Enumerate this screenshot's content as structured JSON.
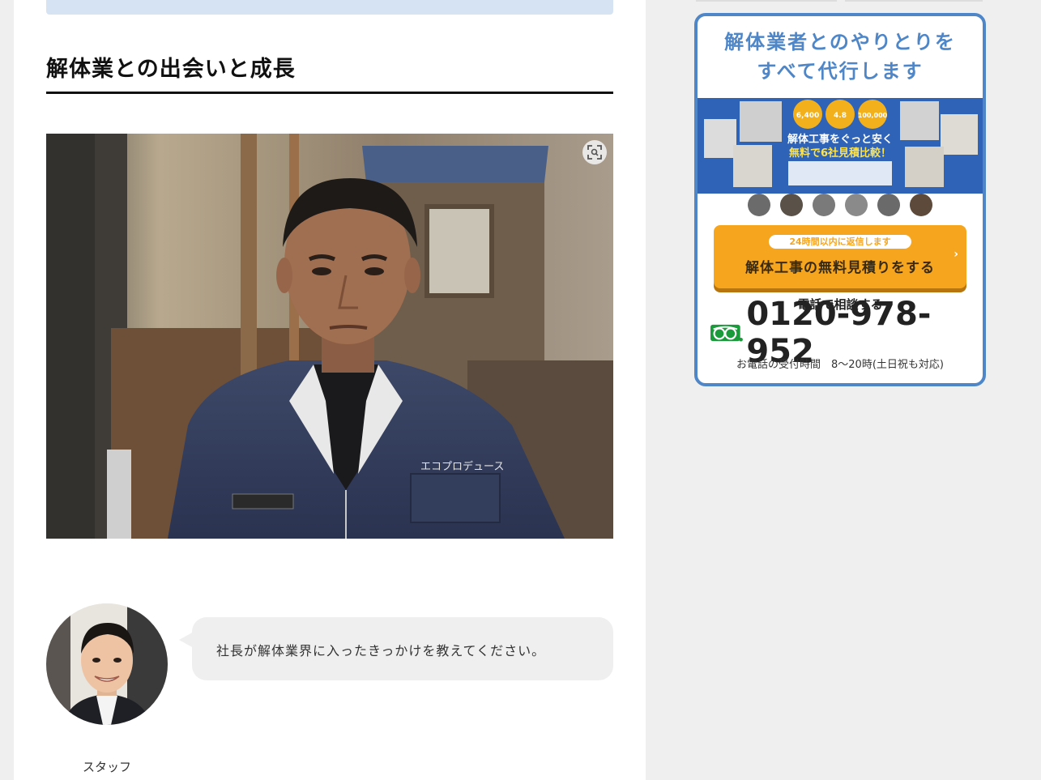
{
  "article": {
    "section_heading": "解体業との出会いと成長",
    "interview": {
      "question": "社長が解体業界に入ったきっかけを教えてください。",
      "speaker_name": "スタッフ"
    },
    "photo_jacket_text": "エコプロデュース"
  },
  "sidebar": {
    "ad": {
      "heading_line1": "解体業者とのやりとりを",
      "heading_line2": "すべて代行します",
      "banner": {
        "headline_line1": "解体工事をぐっと安く",
        "headline_line2": "無料で6社見積比較！",
        "badges": [
          "6,400",
          "4.8",
          "100,000"
        ]
      },
      "cta_sub": "24時間以内に返信します",
      "cta_main": "解体工事の無料見積りをする",
      "cta_arrow": "›",
      "phone_label": "電話で相談する",
      "phone_number": "0120-978-952",
      "phone_hours": "お電話の受付時間　8〜20時(土日祝も対応)"
    }
  },
  "colors": {
    "accent_blue": "#4e86c8",
    "cta_orange": "#f6a51f",
    "freedial_green": "#1a9a3a"
  },
  "icons": [
    "zoom-icon",
    "freedial-icon",
    "chevron-right-icon"
  ]
}
